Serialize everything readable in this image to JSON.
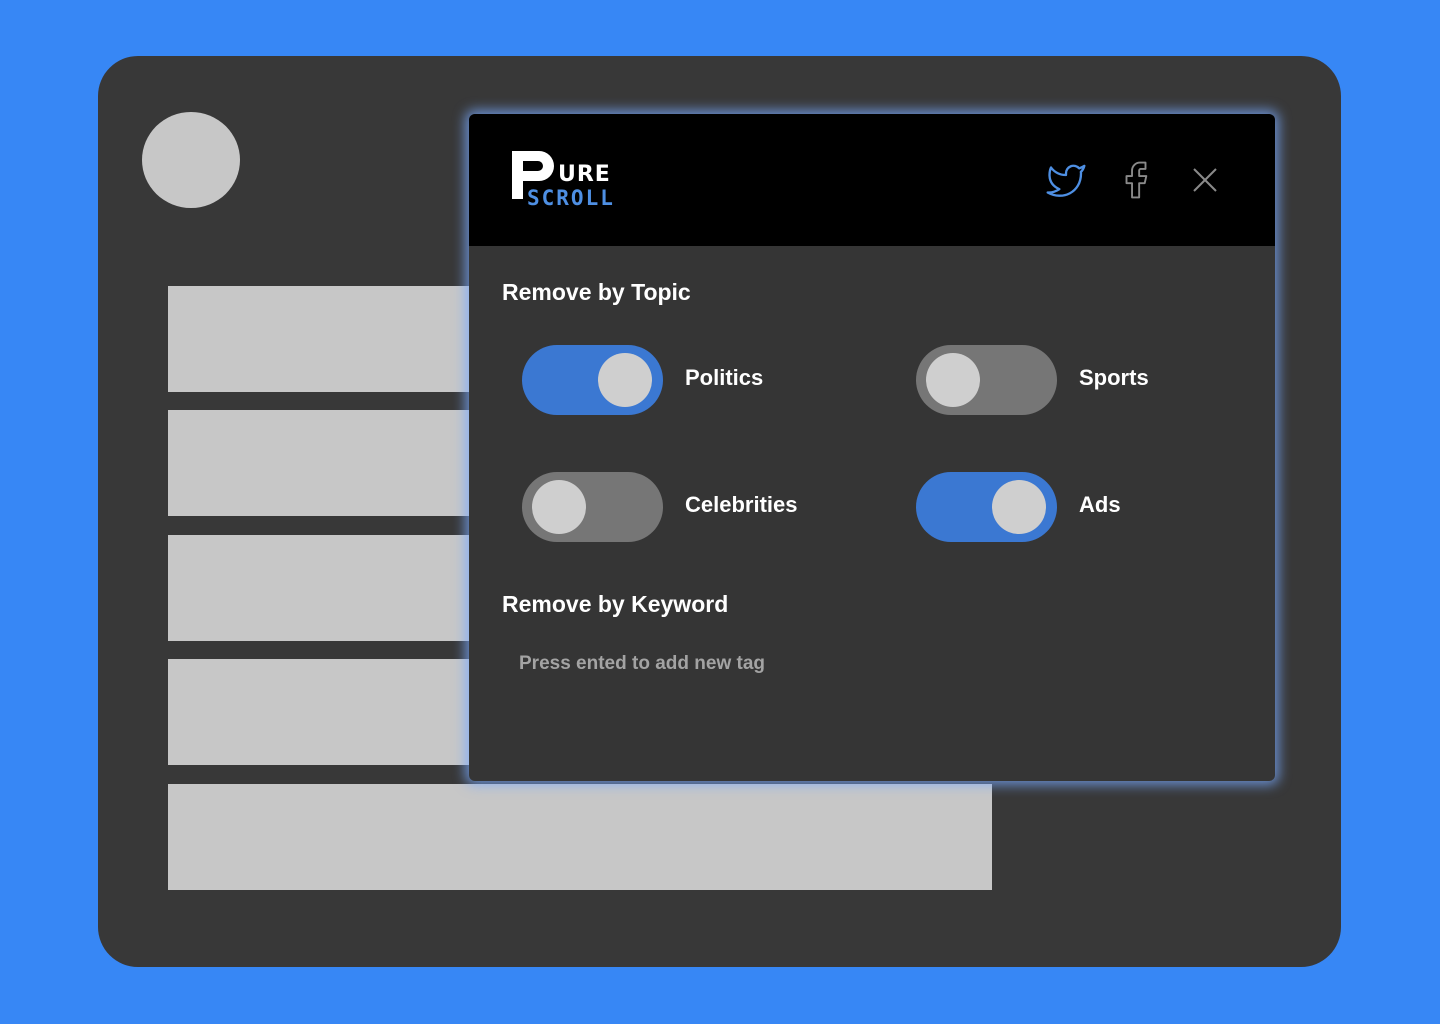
{
  "logo": {
    "p": "P",
    "ure": "URE",
    "scroll": "SCROLL"
  },
  "header": {
    "icons": [
      "twitter-icon",
      "facebook-icon",
      "close-icon"
    ],
    "icon_color": "#4e8fe3"
  },
  "topics": {
    "title": "Remove by Topic",
    "items": [
      {
        "label": "Politics",
        "enabled": true
      },
      {
        "label": "Sports",
        "enabled": false
      },
      {
        "label": "Celebrities",
        "enabled": false
      },
      {
        "label": "Ads",
        "enabled": true
      }
    ]
  },
  "keyword": {
    "title": "Remove by Keyword",
    "placeholder": "Press ented to add new tag",
    "value": ""
  },
  "colors": {
    "background": "#3787f5",
    "device": "#383838",
    "popup": "#353535",
    "toggle_on": "#3b78d2",
    "toggle_off": "#767676"
  }
}
